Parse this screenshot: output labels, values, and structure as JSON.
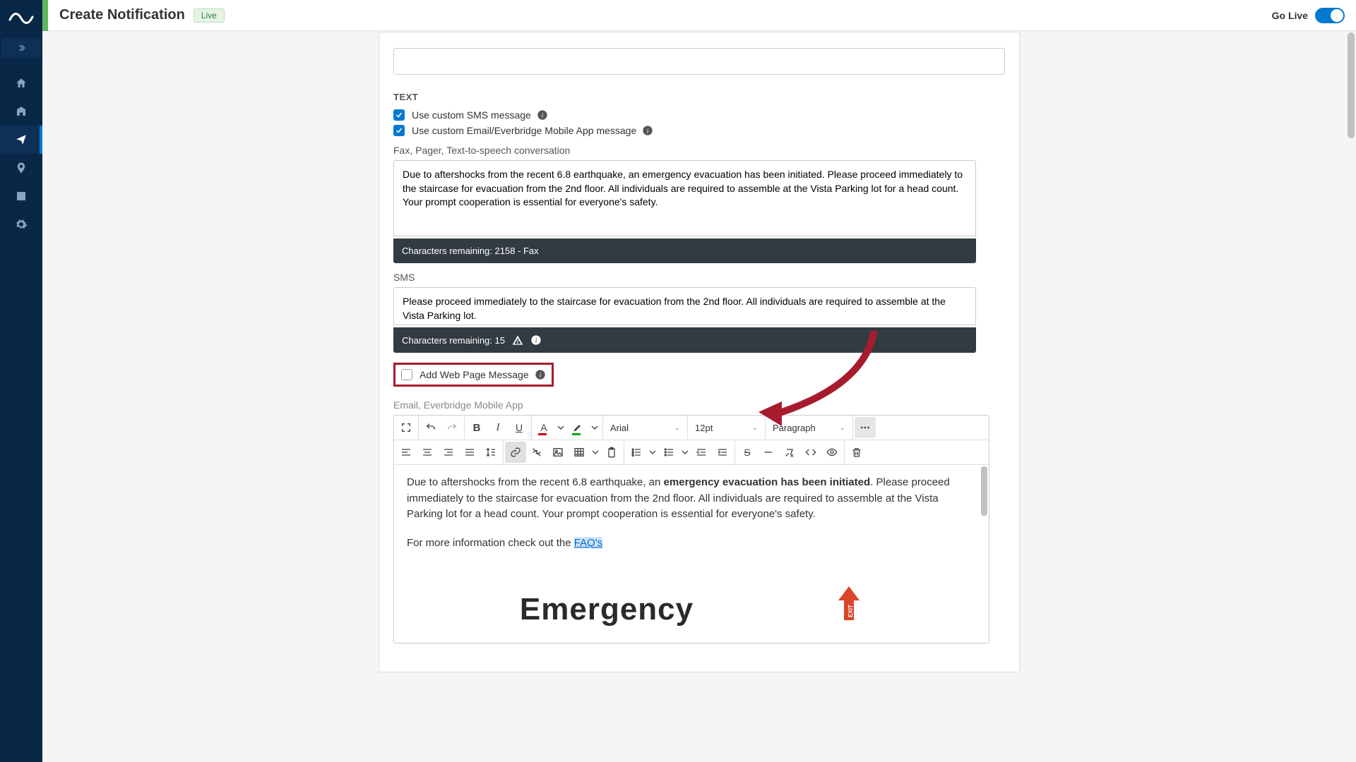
{
  "header": {
    "title": "Create Notification",
    "badge": "Live",
    "golive_label": "Go Live"
  },
  "text_section": {
    "heading": "TEXT",
    "chk_sms": "Use custom SMS message",
    "chk_email": "Use custom Email/Everbridge Mobile App message",
    "fax_label": "Fax, Pager, Text-to-speech conversation",
    "fax_body": "Due to aftershocks from the recent 6.8 earthquake, an emergency evacuation has been initiated. Please proceed immediately to the staircase for evacuation from the 2nd floor. All individuals are required to assemble at the Vista Parking lot for a head count. Your prompt cooperation is essential for everyone's safety.",
    "fax_remaining": "Characters remaining: 2158 - Fax",
    "sms_label": "SMS",
    "sms_body": "Please proceed immediately to the staircase for evacuation from the 2nd floor. All individuals are required to assemble at the Vista Parking lot.",
    "sms_remaining": "Characters remaining: 15",
    "webpage_label": "Add Web Page Message",
    "email_label": "Email, Everbridge Mobile App"
  },
  "editor": {
    "font": "Arial",
    "size": "12pt",
    "block": "Paragraph",
    "body_pre": "Due to aftershocks from the recent 6.8 earthquake, an ",
    "body_bold": "emergency evacuation has been initiated",
    "body_post": ". Please proceed immediately to the staircase for evacuation from the 2nd floor. All individuals are required to assemble at the Vista Parking lot for a head count. Your prompt cooperation is essential for everyone's safety.",
    "body_line2_pre": "For more information check out the ",
    "body_link": "FAQ's",
    "graphic_word": "Emergency"
  }
}
